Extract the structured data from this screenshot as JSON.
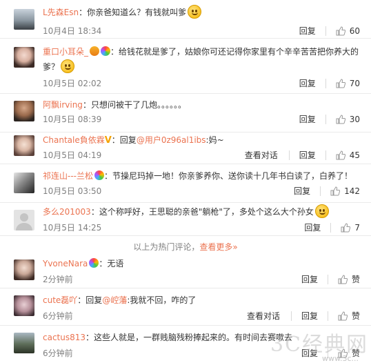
{
  "comments": [
    {
      "user": "L先森Esn",
      "text": "：你亲爸知道么？有钱就叫爹",
      "time": "10月4日 18:34",
      "reply_label": "回复",
      "like_count": "60"
    },
    {
      "user": "重口小耳朵_",
      "text": "：给钱花就是爹了，姑娘你可还记得你家里有个辛辛苦苦把你养大的爹？",
      "time": "10月5日 02:02",
      "reply_label": "回复",
      "like_count": "70"
    },
    {
      "user": "阿飘irving",
      "text": "：只想问被干了几炮。。。。。。",
      "time": "10月5日 08:39",
      "reply_label": "回复",
      "like_count": "30"
    },
    {
      "user": "Chantale負依霖",
      "text_pre": "：回复",
      "mention": "@用户0z96al1ibs",
      "text": ":妈~",
      "time": "10月5日 04:19",
      "view_label": "查看对话",
      "reply_label": "回复",
      "like_count": "45"
    },
    {
      "user": "祁连山---兰松",
      "text": "：节操尼玛掉一地！你亲爹养你、送你读十几年书白读了，白养了！",
      "time": "10月5日 03:50",
      "reply_label": "回复",
      "like_count": "142"
    },
    {
      "user": "多么201003",
      "text": "：这个称呼好，王思聪的亲爸\"躺枪\"了，多处个这么大个孙女",
      "time": "10月5日 14:25",
      "reply_label": "回复",
      "like_count": "7"
    },
    {
      "user": "YvoneNara",
      "text": "：无语",
      "time": "2分钟前",
      "reply_label": "回复",
      "like_label": "赞"
    },
    {
      "user": "cute磊吖",
      "text_pre": "：回复",
      "mention": "@崆藩",
      "text": ":我就不回，咋的了",
      "time": "6分钟前",
      "view_label": "查看对话",
      "reply_label": "回复",
      "like_label": "赞"
    },
    {
      "user": "cactus813",
      "text": "：这些人就是，一群贱脑残粉捧起来的。有时间去赛嗽去",
      "time": "6分钟前",
      "reply_label": "回复",
      "like_label": "赞"
    }
  ],
  "divider": {
    "text": "以上为热门评论，",
    "link": "查看更多»"
  },
  "watermark": {
    "text": "3C经典网",
    "url": "www.3c..."
  },
  "colors": {
    "username": "#eb7350",
    "time": "#808080",
    "border": "#eaeaea"
  }
}
